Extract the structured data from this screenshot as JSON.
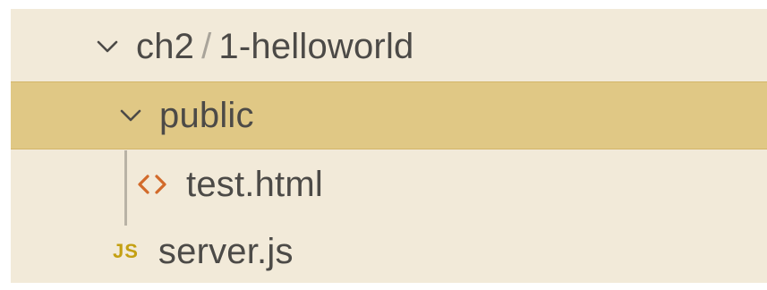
{
  "tree": {
    "root": {
      "parts": [
        "ch2",
        "1-helloworld"
      ],
      "separator": "/",
      "expanded": true
    },
    "folder": {
      "label": "public",
      "expanded": true,
      "selected": true
    },
    "files": [
      {
        "label": "test.html",
        "icon": "html-code-icon",
        "icon_glyph": "<>"
      },
      {
        "label": "server.js",
        "icon": "js-file-icon",
        "icon_glyph": "JS"
      }
    ]
  },
  "colors": {
    "background": "#f2ead9",
    "selection": "#e0c885",
    "html_icon": "#d26a2a",
    "js_icon": "#c4a012",
    "text": "#4c4a47"
  }
}
